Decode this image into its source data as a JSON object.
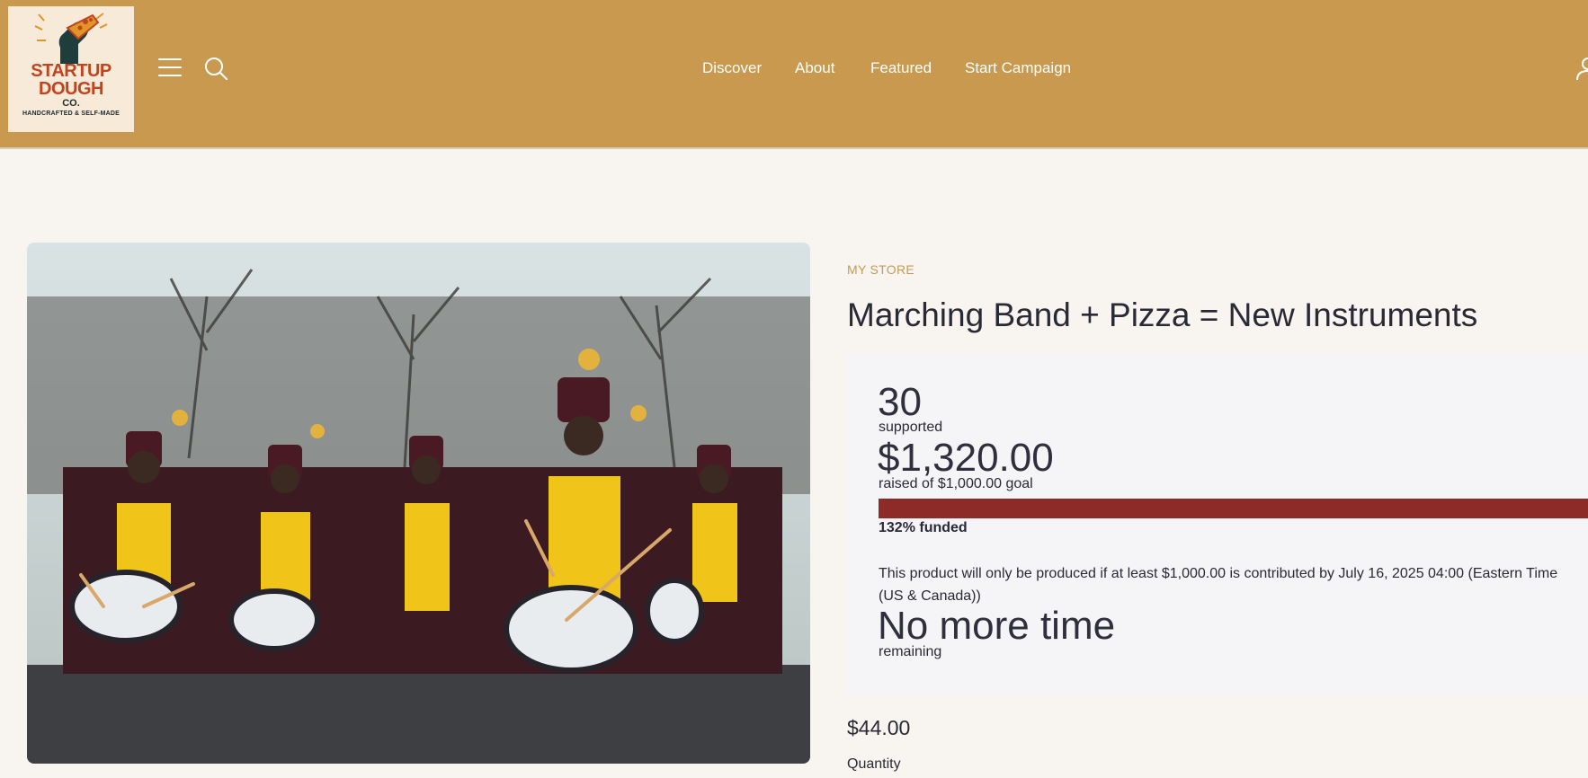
{
  "header": {
    "logo": {
      "line1": "STARTUP",
      "line2": "DOUGH",
      "line3": "CO.",
      "tagline": "HANDCRAFTED & SELF-MADE"
    },
    "nav": [
      {
        "label": "Discover"
      },
      {
        "label": "About"
      },
      {
        "label": "Featured"
      },
      {
        "label": "Start Campaign"
      }
    ],
    "icons": [
      "menu-icon",
      "search-icon",
      "user-icon"
    ],
    "background_color": "#c8994f"
  },
  "product": {
    "store_label": "MY STORE",
    "title": "Marching Band + Pizza = New Instruments",
    "image_alt": "photo of a marching band with drums",
    "price": "$44.00",
    "quantity_label": "Quantity"
  },
  "campaign": {
    "supporters_count": "30",
    "supporters_label": "supported",
    "raised_amount": "$1,320.00",
    "raised_label": "raised of $1,000.00 goal",
    "funded_percent": 1.32,
    "funded_label": "132% funded",
    "note": "This product will only be produced if at least $1,000.00 is contributed by July 16, 2025 04:00 (Eastern Time (US & Canada))",
    "time_remaining": "No more time",
    "remaining_label": "remaining",
    "progress_color": "#8c2b28"
  }
}
